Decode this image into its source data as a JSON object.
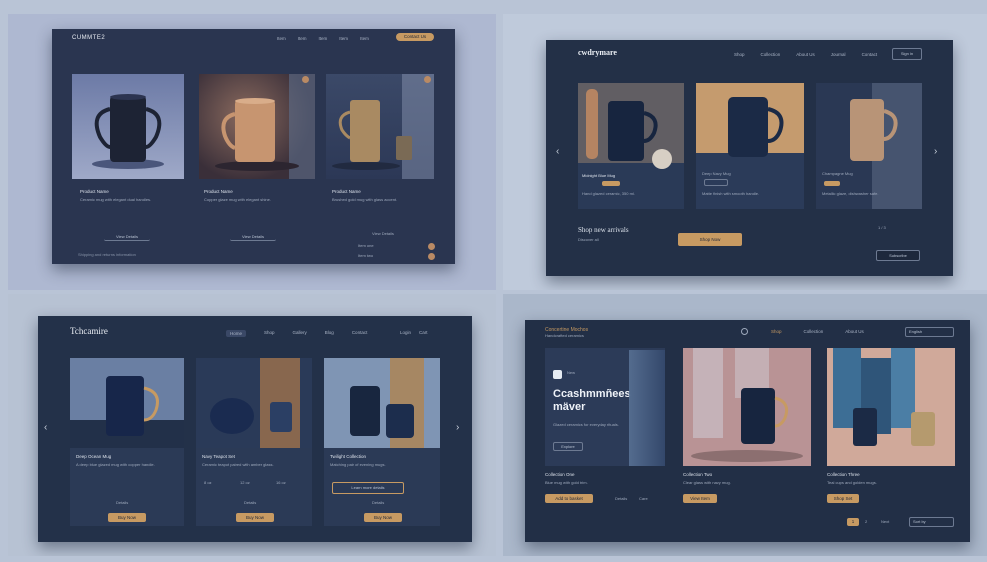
{
  "colors": {
    "accent": "#c79a62",
    "panel": "#243248",
    "background": "#b9c4d6"
  },
  "q1": {
    "brand": "CUMMTE2",
    "nav": [
      "Item",
      "Item",
      "Item",
      "Item",
      "Item"
    ],
    "cta": "Contact Us",
    "cards": [
      {
        "title": "Product Name",
        "body": "Ceramic mug with elegant dual handles."
      },
      {
        "title": "Product Name",
        "body": "Copper glaze mug with elegant shine."
      },
      {
        "title": "Product Name",
        "body": "Brushed gold mug with glass accent."
      }
    ],
    "card_buttons": [
      "View Details",
      "View Details",
      "View Details"
    ],
    "footer": "Shipping and returns information",
    "side_items": [
      "Item one",
      "Item two"
    ]
  },
  "q2": {
    "brand": "cwdrymare",
    "nav": [
      "Shop",
      "Collection",
      "About Us",
      "Journal",
      "Contact"
    ],
    "nav_button": "Sign in",
    "cards": [
      {
        "caption": "Midnight Blue Mug",
        "body": "Hand glazed ceramic, 350 ml."
      },
      {
        "caption": "Deep Navy Mug",
        "body": "Matte finish with smooth handle."
      },
      {
        "caption": "Champagne Mug",
        "body": "Metallic glaze, dishwasher safe."
      }
    ],
    "headline": "Shop new arrivals",
    "subline": "Discover all",
    "cta": "Shop Now",
    "pager": "1 / 3",
    "corner": "Subscribe"
  },
  "q3": {
    "brand": "Tchcamire",
    "nav": [
      "Home",
      "Shop",
      "Gallery",
      "Blog",
      "Contact"
    ],
    "nav_right": [
      "Login",
      "Cart"
    ],
    "cards": [
      {
        "title": "Deep Ocean Mug",
        "body": "A deep blue glazed mug with copper handle.",
        "link": "Details",
        "cta": "Buy Now"
      },
      {
        "title": "Navy Teapot Set",
        "body": "Ceramic teapot paired with amber glass.",
        "link": "Details",
        "cta": "Buy Now"
      },
      {
        "title": "Twilight Collection",
        "body": "Matching pair of evening mugs.",
        "link": "Details",
        "cta": "Buy Now",
        "box": "Learn more details"
      }
    ],
    "specs": [
      "8 oz",
      "12 oz",
      "16 oz"
    ]
  },
  "q4": {
    "brand": "Concertine Mochos",
    "brand_sub": "Handcrafted ceramics",
    "nav": [
      "Shop",
      "Collection",
      "About Us"
    ],
    "select": "English",
    "hero_title": "Ccashmmñees mäver",
    "hero_body": "Glazed ceramics for everyday rituals.",
    "hero_button": "Explore",
    "cards": [
      {
        "title": "Collection One",
        "body": "Blue mug with gold trim.",
        "cta": "Add to basket"
      },
      {
        "title": "Collection Two",
        "body": "Clear glass with navy mug.",
        "cta": "View Item"
      },
      {
        "title": "Collection Three",
        "body": "Teal cups and golden mugs.",
        "cta": "Shop Set"
      }
    ],
    "footer_links": [
      "Details",
      "Care"
    ],
    "pagination": [
      "1",
      "2",
      "Next"
    ],
    "sort": "Sort by"
  }
}
